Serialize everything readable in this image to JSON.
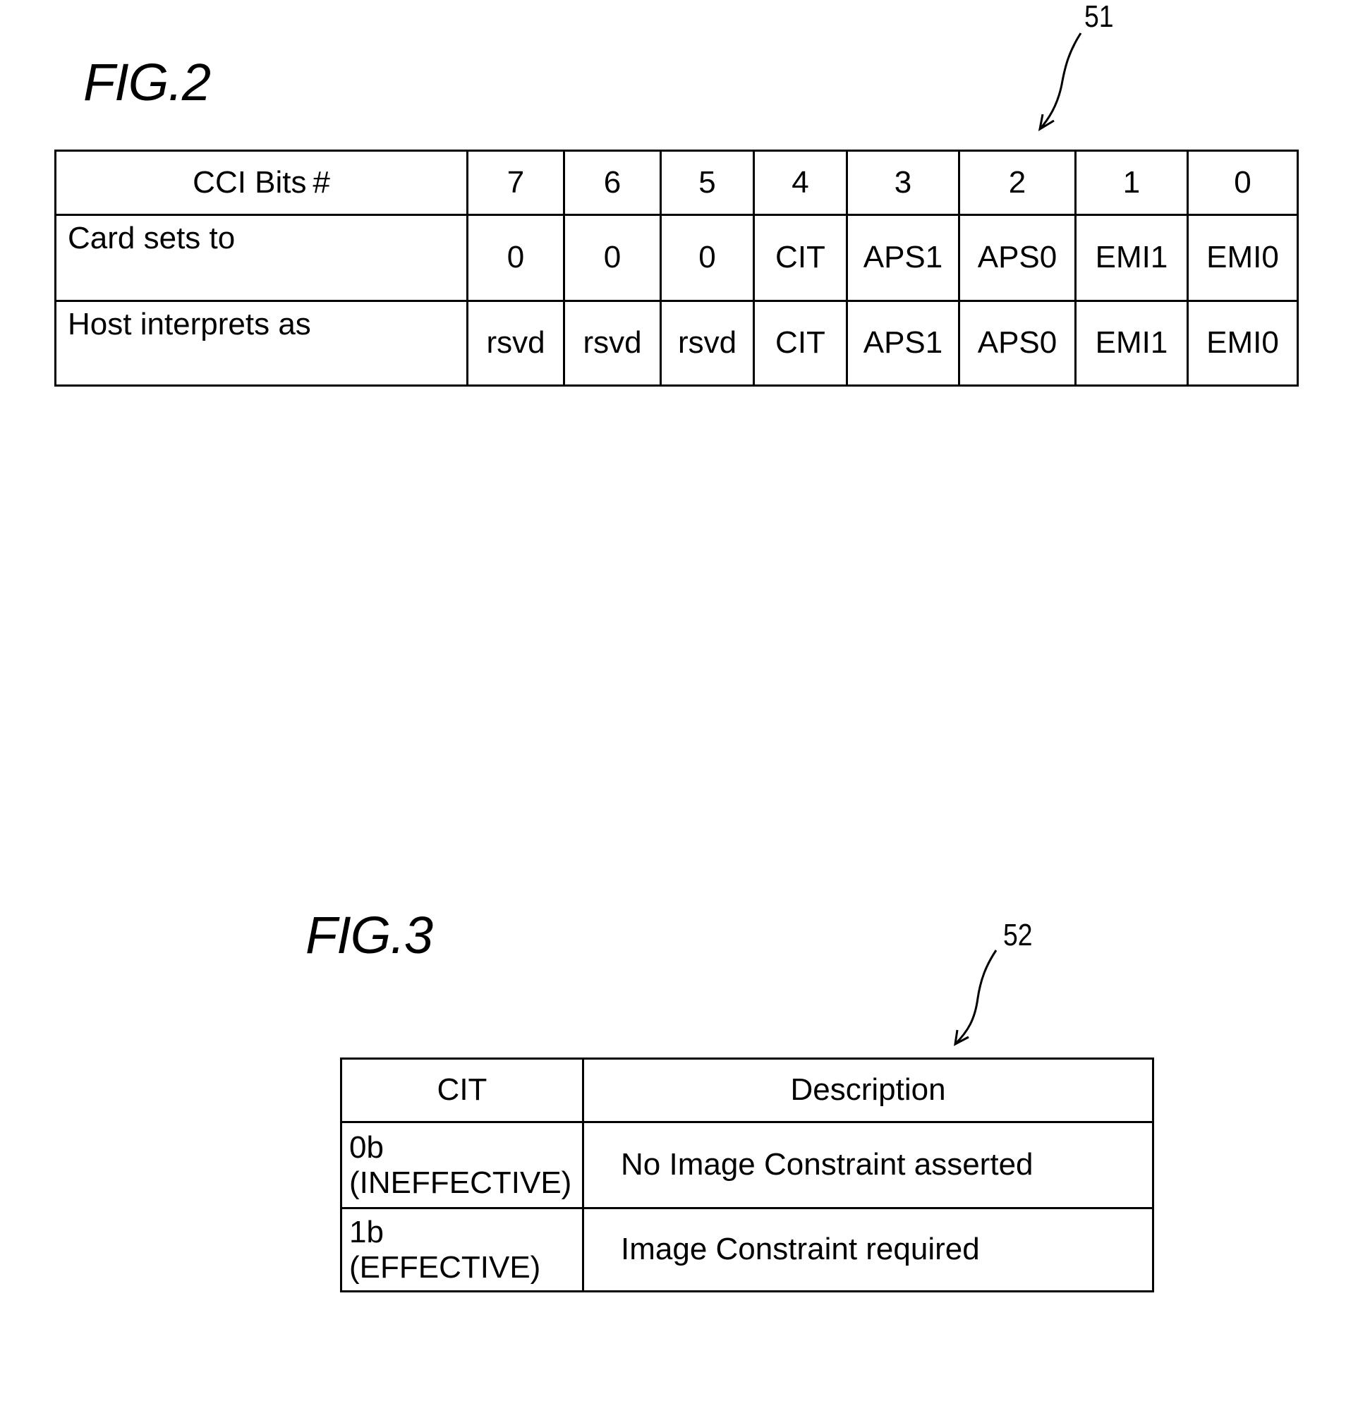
{
  "figures": [
    {
      "label": "FIG.2",
      "reference_number": "51",
      "table": {
        "header": {
          "label": "CCI Bits #",
          "bits": [
            "7",
            "6",
            "5",
            "4",
            "3",
            "2",
            "1",
            "0"
          ]
        },
        "rows": [
          {
            "label": "Card sets to",
            "values": [
              "0",
              "0",
              "0",
              "CIT",
              "APS1",
              "APS0",
              "EMI1",
              "EMI0"
            ]
          },
          {
            "label": "Host interprets as",
            "values": [
              "rsvd",
              "rsvd",
              "rsvd",
              "CIT",
              "APS1",
              "APS0",
              "EMI1",
              "EMI0"
            ]
          }
        ]
      }
    },
    {
      "label": "FIG.3",
      "reference_number": "52",
      "table": {
        "columns": [
          "CIT",
          "Description"
        ],
        "rows": [
          {
            "cit_value": "0b",
            "cit_state": "(INEFFECTIVE)",
            "description": "No Image Constraint asserted"
          },
          {
            "cit_value": "1b",
            "cit_state": "(EFFECTIVE)",
            "description": "Image Constraint required"
          }
        ]
      }
    }
  ]
}
